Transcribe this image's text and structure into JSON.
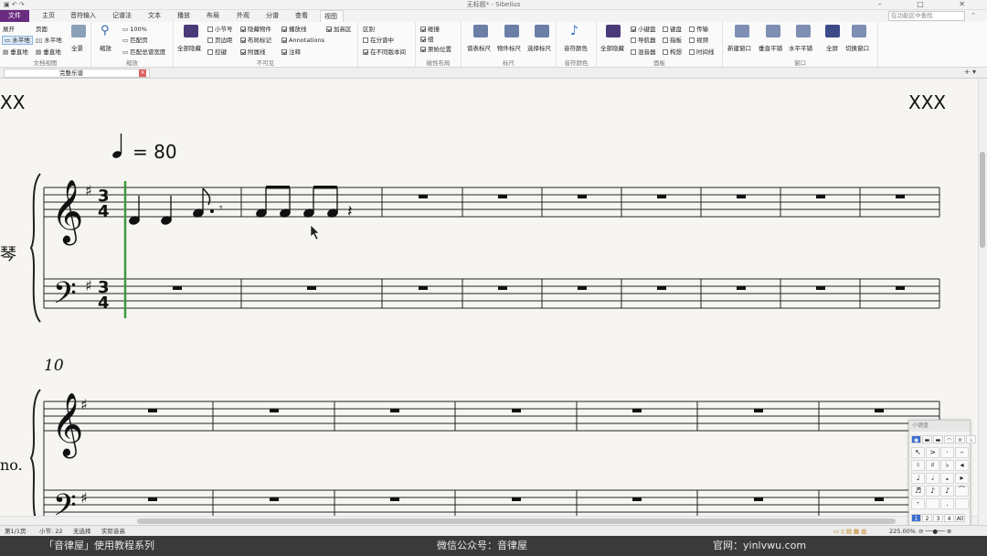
{
  "window": {
    "title": "无标题* - Sibelius",
    "controls": [
      "–",
      "□",
      "✕"
    ]
  },
  "ribbon_tabs": [
    "文件",
    "主页",
    "音符输入",
    "记谱法",
    "文本",
    "播放",
    "布局",
    "外观",
    "分谱",
    "查看",
    "视图"
  ],
  "active_tab": "视图",
  "search": {
    "placeholder": "在功能区中查找"
  },
  "ribbon": {
    "doc_view": {
      "label": "文档视图",
      "items": [
        "展开",
        "页面",
        "水平地",
        "水平地",
        "垂直地",
        "垂直地",
        "全景"
      ]
    },
    "zoom": {
      "label": "缩放",
      "items": [
        "缩放",
        "100%",
        "匹配页",
        "匹配总谱宽度"
      ]
    },
    "invisibles": {
      "label": "不可见",
      "hide_all": "全部隐藏",
      "checks": [
        {
          "label": "小节号",
          "on": false
        },
        {
          "label": "隐藏物件",
          "on": true
        },
        {
          "label": "播放线",
          "on": true
        },
        {
          "label": "加高区",
          "on": true
        },
        {
          "label": "页边距",
          "on": false
        },
        {
          "label": "布局标记",
          "on": true
        },
        {
          "label": "Annotations",
          "on": true
        },
        {
          "label": "控键",
          "on": false
        },
        {
          "label": "附属线",
          "on": true
        },
        {
          "label": "注释",
          "on": true
        }
      ]
    },
    "differences": {
      "label": "区别",
      "checks": [
        {
          "label": "在分谱中",
          "on": false
        },
        {
          "label": "在不同版本间",
          "on": true
        }
      ]
    },
    "magnetic": {
      "label": "磁性布局",
      "checks": [
        {
          "label": "碰撞",
          "on": true
        },
        {
          "label": "组",
          "on": true
        },
        {
          "label": "原始位置",
          "on": true
        }
      ]
    },
    "rulers": {
      "label": "标尺",
      "items": [
        "谱表标尺",
        "物件标尺",
        "选择标尺"
      ]
    },
    "note_colors": {
      "label": "音符颜色",
      "items": [
        "音符颜色"
      ]
    },
    "panels": {
      "label": "面板",
      "hide_all": "全部隐藏",
      "checks": [
        {
          "label": "小键盘",
          "on": true
        },
        {
          "label": "键盘",
          "on": false
        },
        {
          "label": "传输",
          "on": false
        },
        {
          "label": "导航器",
          "on": false
        },
        {
          "label": "指板",
          "on": false
        },
        {
          "label": "视频",
          "on": false
        },
        {
          "label": "混音器",
          "on": false
        },
        {
          "label": "构想",
          "on": false
        },
        {
          "label": "时间线",
          "on": false
        }
      ]
    },
    "window": {
      "label": "窗口",
      "items": [
        "新建窗口",
        "垂直平铺",
        "水平平铺",
        "全屏",
        "切换窗口"
      ]
    }
  },
  "document_tab": "完整乐谱",
  "score": {
    "header_left": "XX",
    "header_right": "XXX",
    "tempo": "= 80",
    "instrument_full": "琴",
    "instrument_short": "no.",
    "bar_number": "10",
    "time_signature": "3/4",
    "key": "G major (1 sharp)"
  },
  "status": {
    "page": "第1/1页",
    "bar": "小节: 22",
    "selection": "无选择",
    "pitch": "实际音高",
    "zoom": "225.00%"
  },
  "keypad": {
    "title": "小键盘",
    "tabs": [
      "1",
      "2",
      "3",
      "4",
      "All"
    ]
  },
  "footer": {
    "left": "「音律屋」使用教程系列",
    "center": "微信公众号：音律屋",
    "right": "官网：yinlvwu.com"
  }
}
